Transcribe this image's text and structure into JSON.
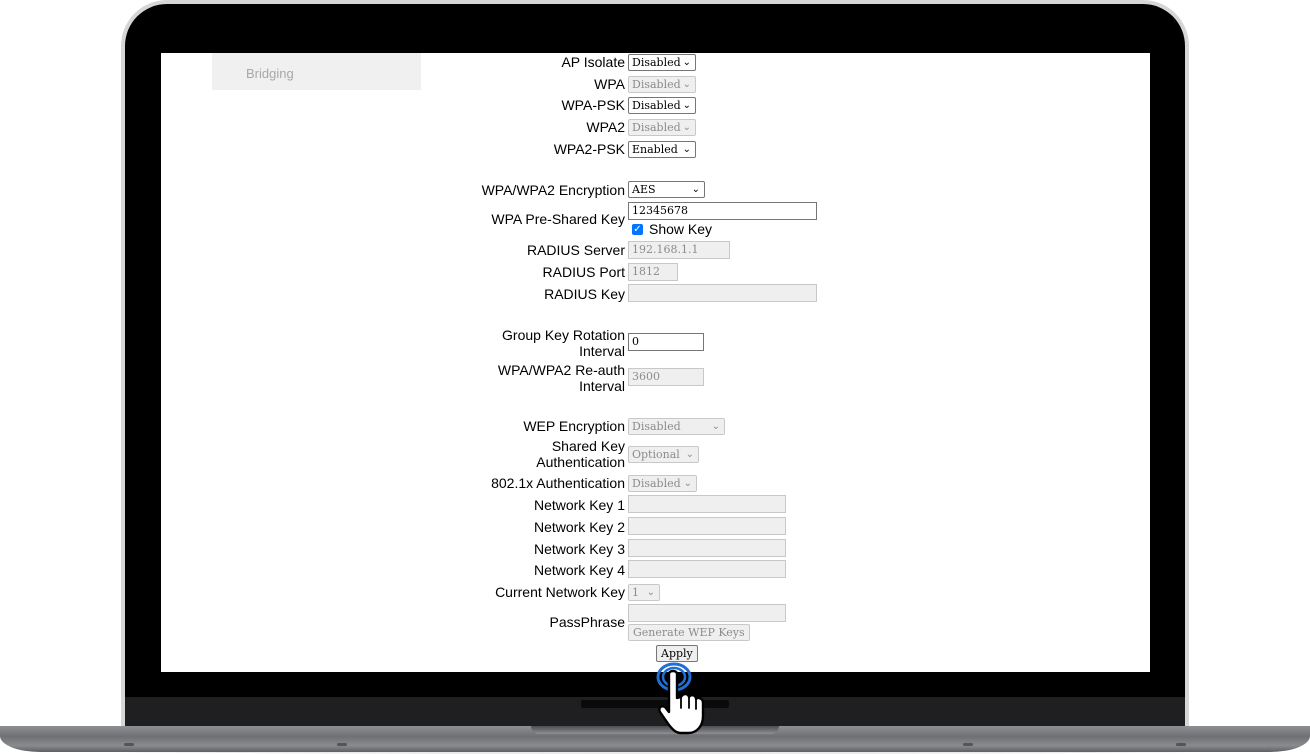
{
  "sidebar": {
    "bridging_label": "Bridging"
  },
  "form": {
    "ap_isolate": {
      "label": "AP Isolate",
      "value": "Disabled"
    },
    "wpa": {
      "label": "WPA",
      "value": "Disabled"
    },
    "wpa_psk": {
      "label": "WPA-PSK",
      "value": "Disabled"
    },
    "wpa2": {
      "label": "WPA2",
      "value": "Disabled"
    },
    "wpa2_psk": {
      "label": "WPA2-PSK",
      "value": "Enabled"
    },
    "encryption": {
      "label": "WPA/WPA2 Encryption",
      "value": "AES"
    },
    "psk": {
      "label": "WPA Pre-Shared Key",
      "value": "12345678",
      "show_key_label": "Show Key",
      "show_key_checked": true
    },
    "radius_server": {
      "label": "RADIUS Server",
      "value": "192.168.1.1"
    },
    "radius_port": {
      "label": "RADIUS Port",
      "value": "1812"
    },
    "radius_key": {
      "label": "RADIUS Key",
      "value": ""
    },
    "group_key": {
      "label_line1": "Group Key Rotation",
      "label_line2": "Interval",
      "value": "0"
    },
    "reauth": {
      "label_line1": "WPA/WPA2 Re-auth",
      "label_line2": "Interval",
      "value": "3600"
    },
    "wep_encryption": {
      "label": "WEP Encryption",
      "value": "Disabled"
    },
    "shared_key_auth": {
      "label_line1": "Shared Key",
      "label_line2": "Authentication",
      "value": "Optional"
    },
    "dot1x_auth": {
      "label": "802.1x Authentication",
      "value": "Disabled"
    },
    "network_key_1": {
      "label": "Network Key 1",
      "value": ""
    },
    "network_key_2": {
      "label": "Network Key 2",
      "value": ""
    },
    "network_key_3": {
      "label": "Network Key 3",
      "value": ""
    },
    "network_key_4": {
      "label": "Network Key 4",
      "value": ""
    },
    "current_network_key": {
      "label": "Current Network Key",
      "value": "1"
    },
    "passphrase": {
      "label": "PassPhrase",
      "value": "",
      "generate_label": "Generate WEP Keys"
    },
    "apply_label": "Apply"
  },
  "icons": {
    "pointer": "hand-pointer-icon",
    "chevron": "chevron-down-icon",
    "check": "checkmark-icon"
  }
}
